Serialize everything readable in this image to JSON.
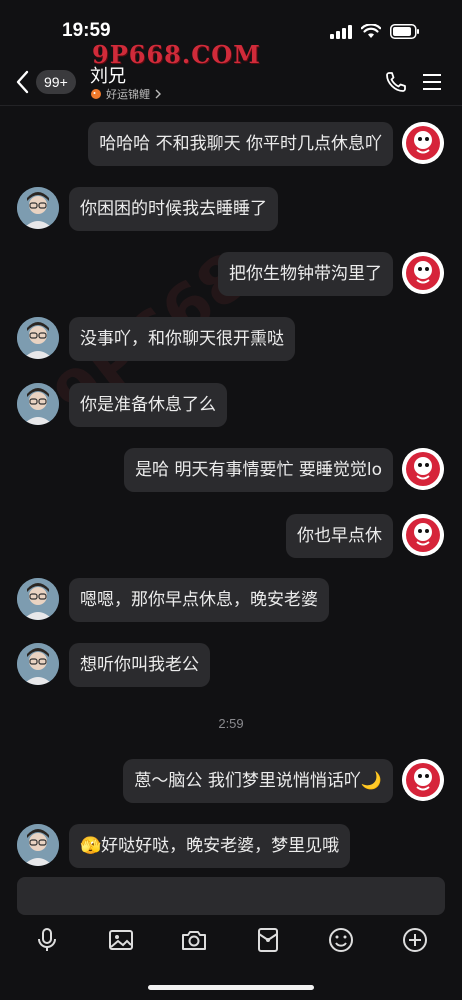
{
  "status_bar": {
    "time": "19:59"
  },
  "watermark": "9P668.COM",
  "header": {
    "unread_count": "99+",
    "contact_name": "刘兄",
    "subtitle": "好运锦鲤"
  },
  "messages": [
    {
      "side": "me",
      "text": "哈哈哈 不和我聊天 你平时几点休息吖"
    },
    {
      "side": "contact",
      "text": "你困困的时候我去睡睡了"
    },
    {
      "side": "me",
      "text": "把你生物钟带沟里了"
    },
    {
      "side": "contact",
      "text": "没事吖，和你聊天很开熏哒"
    },
    {
      "side": "contact",
      "text": "你是准备休息了么"
    },
    {
      "side": "me",
      "text": "是哈  明天有事情要忙 要睡觉觉lo"
    },
    {
      "side": "me",
      "text": "你也早点休"
    },
    {
      "side": "contact",
      "text": "嗯嗯，那你早点休息，晚安老婆"
    },
    {
      "side": "contact",
      "text": "想听你叫我老公"
    },
    {
      "side": "me",
      "text": "蒽～脑公 我们梦里说悄悄话吖🌙"
    },
    {
      "side": "contact",
      "text": "🫣好哒好哒，晚安老婆，梦里见哦"
    }
  ],
  "time_divider": "2:59",
  "input": {
    "value": ""
  },
  "toolbar_icons": [
    "microphone-icon",
    "image-icon",
    "camera-icon",
    "red-packet-icon",
    "emoji-icon",
    "plus-icon"
  ]
}
